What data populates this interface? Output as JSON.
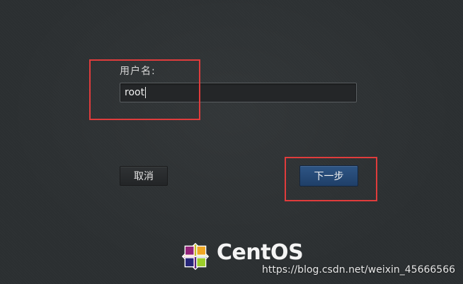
{
  "login": {
    "username_label": "用户名:",
    "username_value": "root",
    "cancel_label": "取消",
    "next_label": "下一步"
  },
  "branding": {
    "wordmark": "CentOS",
    "logo_icon": "centos-logo-icon"
  },
  "watermark": "https://blog.csdn.net/weixin_45666566",
  "colors": {
    "background": "#2b2f31",
    "next_button": "#2a4f7d",
    "highlight": "#e03c3c"
  }
}
